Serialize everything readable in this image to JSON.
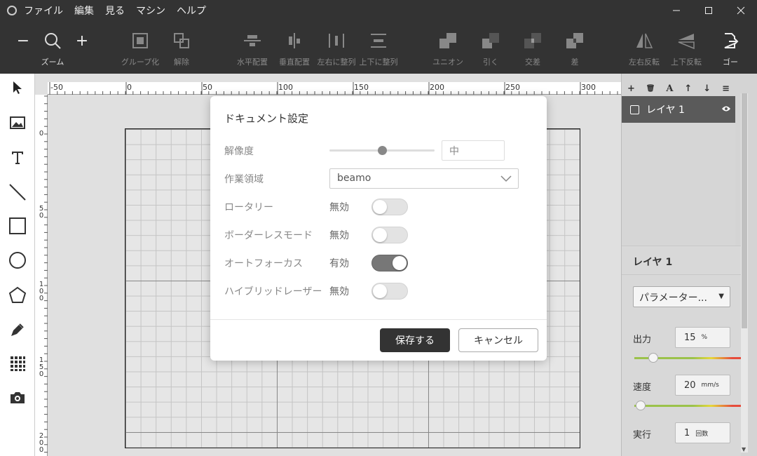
{
  "menu": [
    "ファイル",
    "編集",
    "見る",
    "マシン",
    "ヘルプ"
  ],
  "toolbar": {
    "zoom_label": "ズーム",
    "zoom_out": "−",
    "zoom_in": "+",
    "group": "グループ化",
    "ungroup": "解除",
    "align_h": "水平配置",
    "align_v": "垂直配置",
    "align_lr": "左右に整列",
    "align_tb": "上下に整列",
    "union": "ユニオン",
    "subtract": "引く",
    "intersect": "交差",
    "difference": "差",
    "flip_h": "左右反転",
    "flip_v": "上下反転",
    "go": "ゴー"
  },
  "ruler": {
    "top": [
      "-50",
      "0",
      "50",
      "100",
      "150",
      "200",
      "250",
      "300"
    ],
    "left": [
      "0",
      "50",
      "100",
      "150",
      "200"
    ]
  },
  "layers": {
    "tool_icons": [
      "+",
      "🗑",
      "A",
      "↑",
      "↓",
      "≡"
    ],
    "items": [
      {
        "name": "レイヤ 1"
      }
    ]
  },
  "layer_settings": {
    "title": "レイヤ 1",
    "preset": "パラメーター...",
    "power_label": "出力",
    "power_value": "15",
    "power_unit": "%",
    "power_fraction": 0.15,
    "speed_label": "速度",
    "speed_value": "20",
    "speed_unit": "mm/s",
    "speed_fraction": 0.06,
    "repeat_label": "実行",
    "repeat_value": "1",
    "repeat_unit": "回数"
  },
  "modal": {
    "title": "ドキュメント設定",
    "resolution_label": "解像度",
    "resolution_value": "中",
    "resolution_level": 0.5,
    "workspace_label": "作業領域",
    "workspace_value": "beamo",
    "rotary_label": "ロータリー",
    "rotary_status": "無効",
    "rotary_on": false,
    "borderless_label": "ボーダーレスモード",
    "borderless_status": "無効",
    "borderless_on": false,
    "autofocus_label": "オートフォーカス",
    "autofocus_status": "有効",
    "autofocus_on": true,
    "hybrid_label": "ハイブリッドレーザー",
    "hybrid_status": "無効",
    "hybrid_on": false,
    "save": "保存する",
    "cancel": "キャンセル"
  },
  "colors": {
    "toolbar_bg": "#333333",
    "save_button": "#333333",
    "layer_selected": "#5a5a5a"
  }
}
